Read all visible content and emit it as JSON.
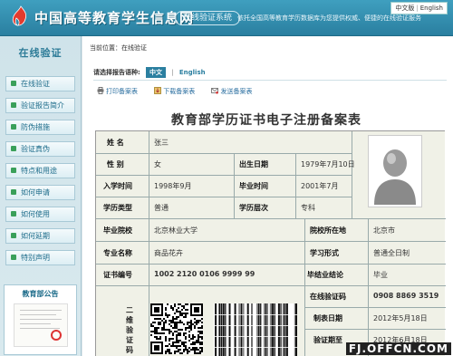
{
  "header": {
    "logo_text": "中国高等教育学生信息网",
    "sub_badge": "在线验证系统",
    "description": "依托全国高等教育学历数据库为您提供权威、便捷的在线验证服务",
    "lang_cn": "中文版",
    "lang_en": "English"
  },
  "sidebar": {
    "title": "在线验证",
    "items": [
      {
        "label": "在线验证"
      },
      {
        "label": "验证报告简介"
      },
      {
        "label": "防伪措施"
      },
      {
        "label": "验证真伪"
      },
      {
        "label": "特点和用途"
      },
      {
        "label": "如何申请"
      },
      {
        "label": "如何使用"
      },
      {
        "label": "如何延期"
      },
      {
        "label": "特别声明"
      }
    ],
    "notice_title": "教育部公告"
  },
  "main": {
    "breadcrumb": "当前位置：在线验证",
    "lang_prompt": "请选择报告语种:",
    "lang_active": "中文",
    "lang_sep": "|",
    "lang_other": "English",
    "actions": [
      "打印备案表",
      "下载备案表",
      "发送备案表"
    ],
    "title": "教育部学历证书电子注册备案表"
  },
  "cert": {
    "name_label": "姓    名",
    "name_value": "张三",
    "gender_label": "性    别",
    "gender_value": "女",
    "birth_label": "出生日期",
    "birth_value": "1979年7月10日",
    "enroll_label": "入学时间",
    "enroll_value": "1998年9月",
    "grad_label": "毕业时间",
    "grad_value": "2001年7月",
    "type_label": "学历类型",
    "type_value": "普通",
    "level_label": "学历层次",
    "level_value": "专科",
    "school_label": "毕业院校",
    "school_value": "北京林业大学",
    "location_label": "院校所在地",
    "location_value": "北京市",
    "major_label": "专业名称",
    "major_value": "商品花卉",
    "form_label": "学习形式",
    "form_value": "普通全日制",
    "cert_no_label": "证书编号",
    "cert_no_value": "1002 2120 0106 9999 99",
    "conclusion_label": "毕结业结论",
    "conclusion_value": "毕业",
    "code_label": "二维验证码",
    "verify_code_label": "在线验证码",
    "verify_code_value": "0908 8869 3519",
    "made_date_label": "制表日期",
    "made_date_value": "2012年5月18日",
    "valid_until_label": "验证期至",
    "valid_until_value": "2012年6月18日"
  },
  "watermark": "FJ.OFFCN.COM",
  "colors": {
    "header_blue": "#2a7fa0",
    "menu_bullet": "#3aa05a",
    "link_blue": "#2b6fa0"
  },
  "icons": [
    "logo-flame-icon",
    "bullet-icon",
    "print-icon",
    "download-icon",
    "send-icon",
    "avatar-placeholder-icon",
    "qr-code-icon",
    "barcode-icon"
  ]
}
